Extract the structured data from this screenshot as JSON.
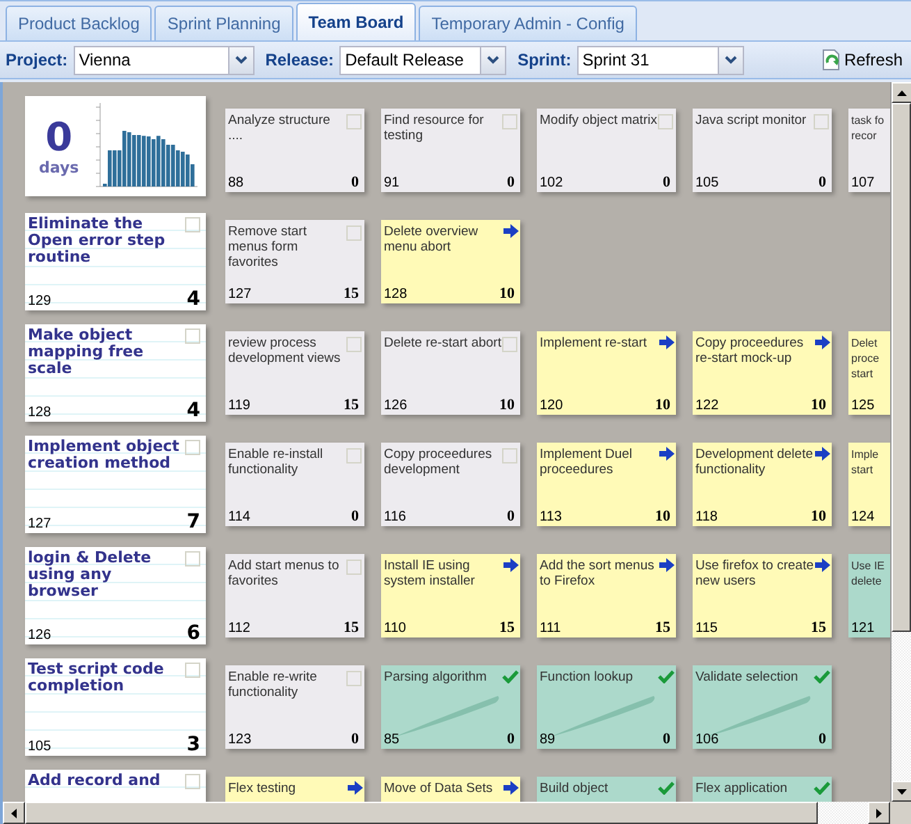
{
  "tabs": [
    {
      "label": "Product Backlog",
      "selected": false
    },
    {
      "label": "Sprint Planning",
      "selected": false
    },
    {
      "label": "Team Board",
      "selected": true
    },
    {
      "label": "Temporary Admin - Config",
      "selected": false
    }
  ],
  "filters": [
    {
      "label": "Project:",
      "value": "Vienna"
    },
    {
      "label": "Release:",
      "value": "Default Release"
    },
    {
      "label": "Sprint:",
      "value": "Sprint 31"
    }
  ],
  "refresh": "Refresh",
  "rows": [
    {
      "header": {
        "kind": "summary",
        "count": "0",
        "unit": "days"
      },
      "tasks": [
        {
          "title": "Analyze structure ....",
          "id": "88",
          "estimate": "0",
          "kind": "todo",
          "checked": false
        },
        {
          "title": "Find resource for testing",
          "id": "91",
          "estimate": "0",
          "kind": "todo",
          "checked": false
        },
        {
          "title": "Modify object matrix",
          "id": "102",
          "estimate": "0",
          "kind": "todo",
          "checked": false
        },
        {
          "title": "Java script monitor",
          "id": "105",
          "estimate": "0",
          "kind": "todo",
          "checked": false
        },
        {
          "title": "task fo\nrecor",
          "id": "107",
          "kind": "todo"
        }
      ]
    },
    {
      "header": {
        "kind": "story",
        "title": "Eliminate the Open error step routine",
        "id": "129",
        "points": "4",
        "checked": false
      },
      "tasks": [
        {
          "title": "Remove start menus form favorites",
          "id": "127",
          "estimate": "15",
          "kind": "todo",
          "checked": false
        },
        {
          "title": "Delete overview menu abort",
          "id": "128",
          "estimate": "10",
          "kind": "doing"
        }
      ]
    },
    {
      "header": {
        "kind": "story",
        "title": "Make object mapping free scale",
        "id": "128",
        "points": "4",
        "checked": false
      },
      "tasks": [
        {
          "title": "review process development views",
          "id": "119",
          "estimate": "15",
          "kind": "todo",
          "checked": false
        },
        {
          "title": "Delete re-start abort",
          "id": "126",
          "estimate": "10",
          "kind": "todo",
          "checked": false
        },
        {
          "title": "Implement re-start",
          "id": "120",
          "estimate": "10",
          "kind": "doing"
        },
        {
          "title": "Copy proceedures re-start mock-up",
          "id": "122",
          "estimate": "10",
          "kind": "doing"
        },
        {
          "title": "Delet\nproce\nstart",
          "id": "125",
          "kind": "doing"
        }
      ]
    },
    {
      "header": {
        "kind": "story",
        "title": "Implement object creation method",
        "id": "127",
        "points": "7",
        "checked": false
      },
      "tasks": [
        {
          "title": "Enable re-install functionality",
          "id": "114",
          "estimate": "0",
          "kind": "todo",
          "checked": false
        },
        {
          "title": "Copy proceedures development",
          "id": "116",
          "estimate": "0",
          "kind": "todo",
          "checked": false
        },
        {
          "title": "Implement Duel proceedures",
          "id": "113",
          "estimate": "10",
          "kind": "doing"
        },
        {
          "title": "Development delete functionality",
          "id": "118",
          "estimate": "10",
          "kind": "doing"
        },
        {
          "title": "Imple\nstart",
          "id": "124",
          "kind": "doing"
        }
      ]
    },
    {
      "header": {
        "kind": "story",
        "title": "login & Delete using any browser",
        "id": "126",
        "points": "6",
        "checked": false
      },
      "tasks": [
        {
          "title": "Add start menus to favorites",
          "id": "112",
          "estimate": "15",
          "kind": "todo",
          "checked": false
        },
        {
          "title": "Install IE using system installer",
          "id": "110",
          "estimate": "15",
          "kind": "doing"
        },
        {
          "title": "Add the sort menus to Firefox",
          "id": "111",
          "estimate": "15",
          "kind": "doing"
        },
        {
          "title": "Use firefox to create new users",
          "id": "115",
          "estimate": "15",
          "kind": "doing"
        },
        {
          "title": "Use IE\ndelete",
          "id": "121",
          "kind": "done"
        }
      ]
    },
    {
      "header": {
        "kind": "story",
        "title": "Test script code completion",
        "id": "105",
        "points": "3",
        "checked": false
      },
      "tasks": [
        {
          "title": "Enable re-write functionality",
          "id": "123",
          "estimate": "0",
          "kind": "todo",
          "checked": false
        },
        {
          "title": "Parsing algorithm",
          "id": "85",
          "estimate": "0",
          "kind": "done"
        },
        {
          "title": "Function lookup",
          "id": "89",
          "estimate": "0",
          "kind": "done"
        },
        {
          "title": "Validate selection",
          "id": "106",
          "estimate": "0",
          "kind": "done"
        }
      ]
    },
    {
      "header": {
        "kind": "story",
        "title": "Add record and",
        "checked": false
      },
      "tasks": [
        {
          "title": "Flex testing",
          "kind": "doing"
        },
        {
          "title": "Move of Data Sets",
          "kind": "doing"
        },
        {
          "title": "Build object",
          "kind": "done"
        },
        {
          "title": "Flex application",
          "kind": "done"
        }
      ]
    }
  ]
}
